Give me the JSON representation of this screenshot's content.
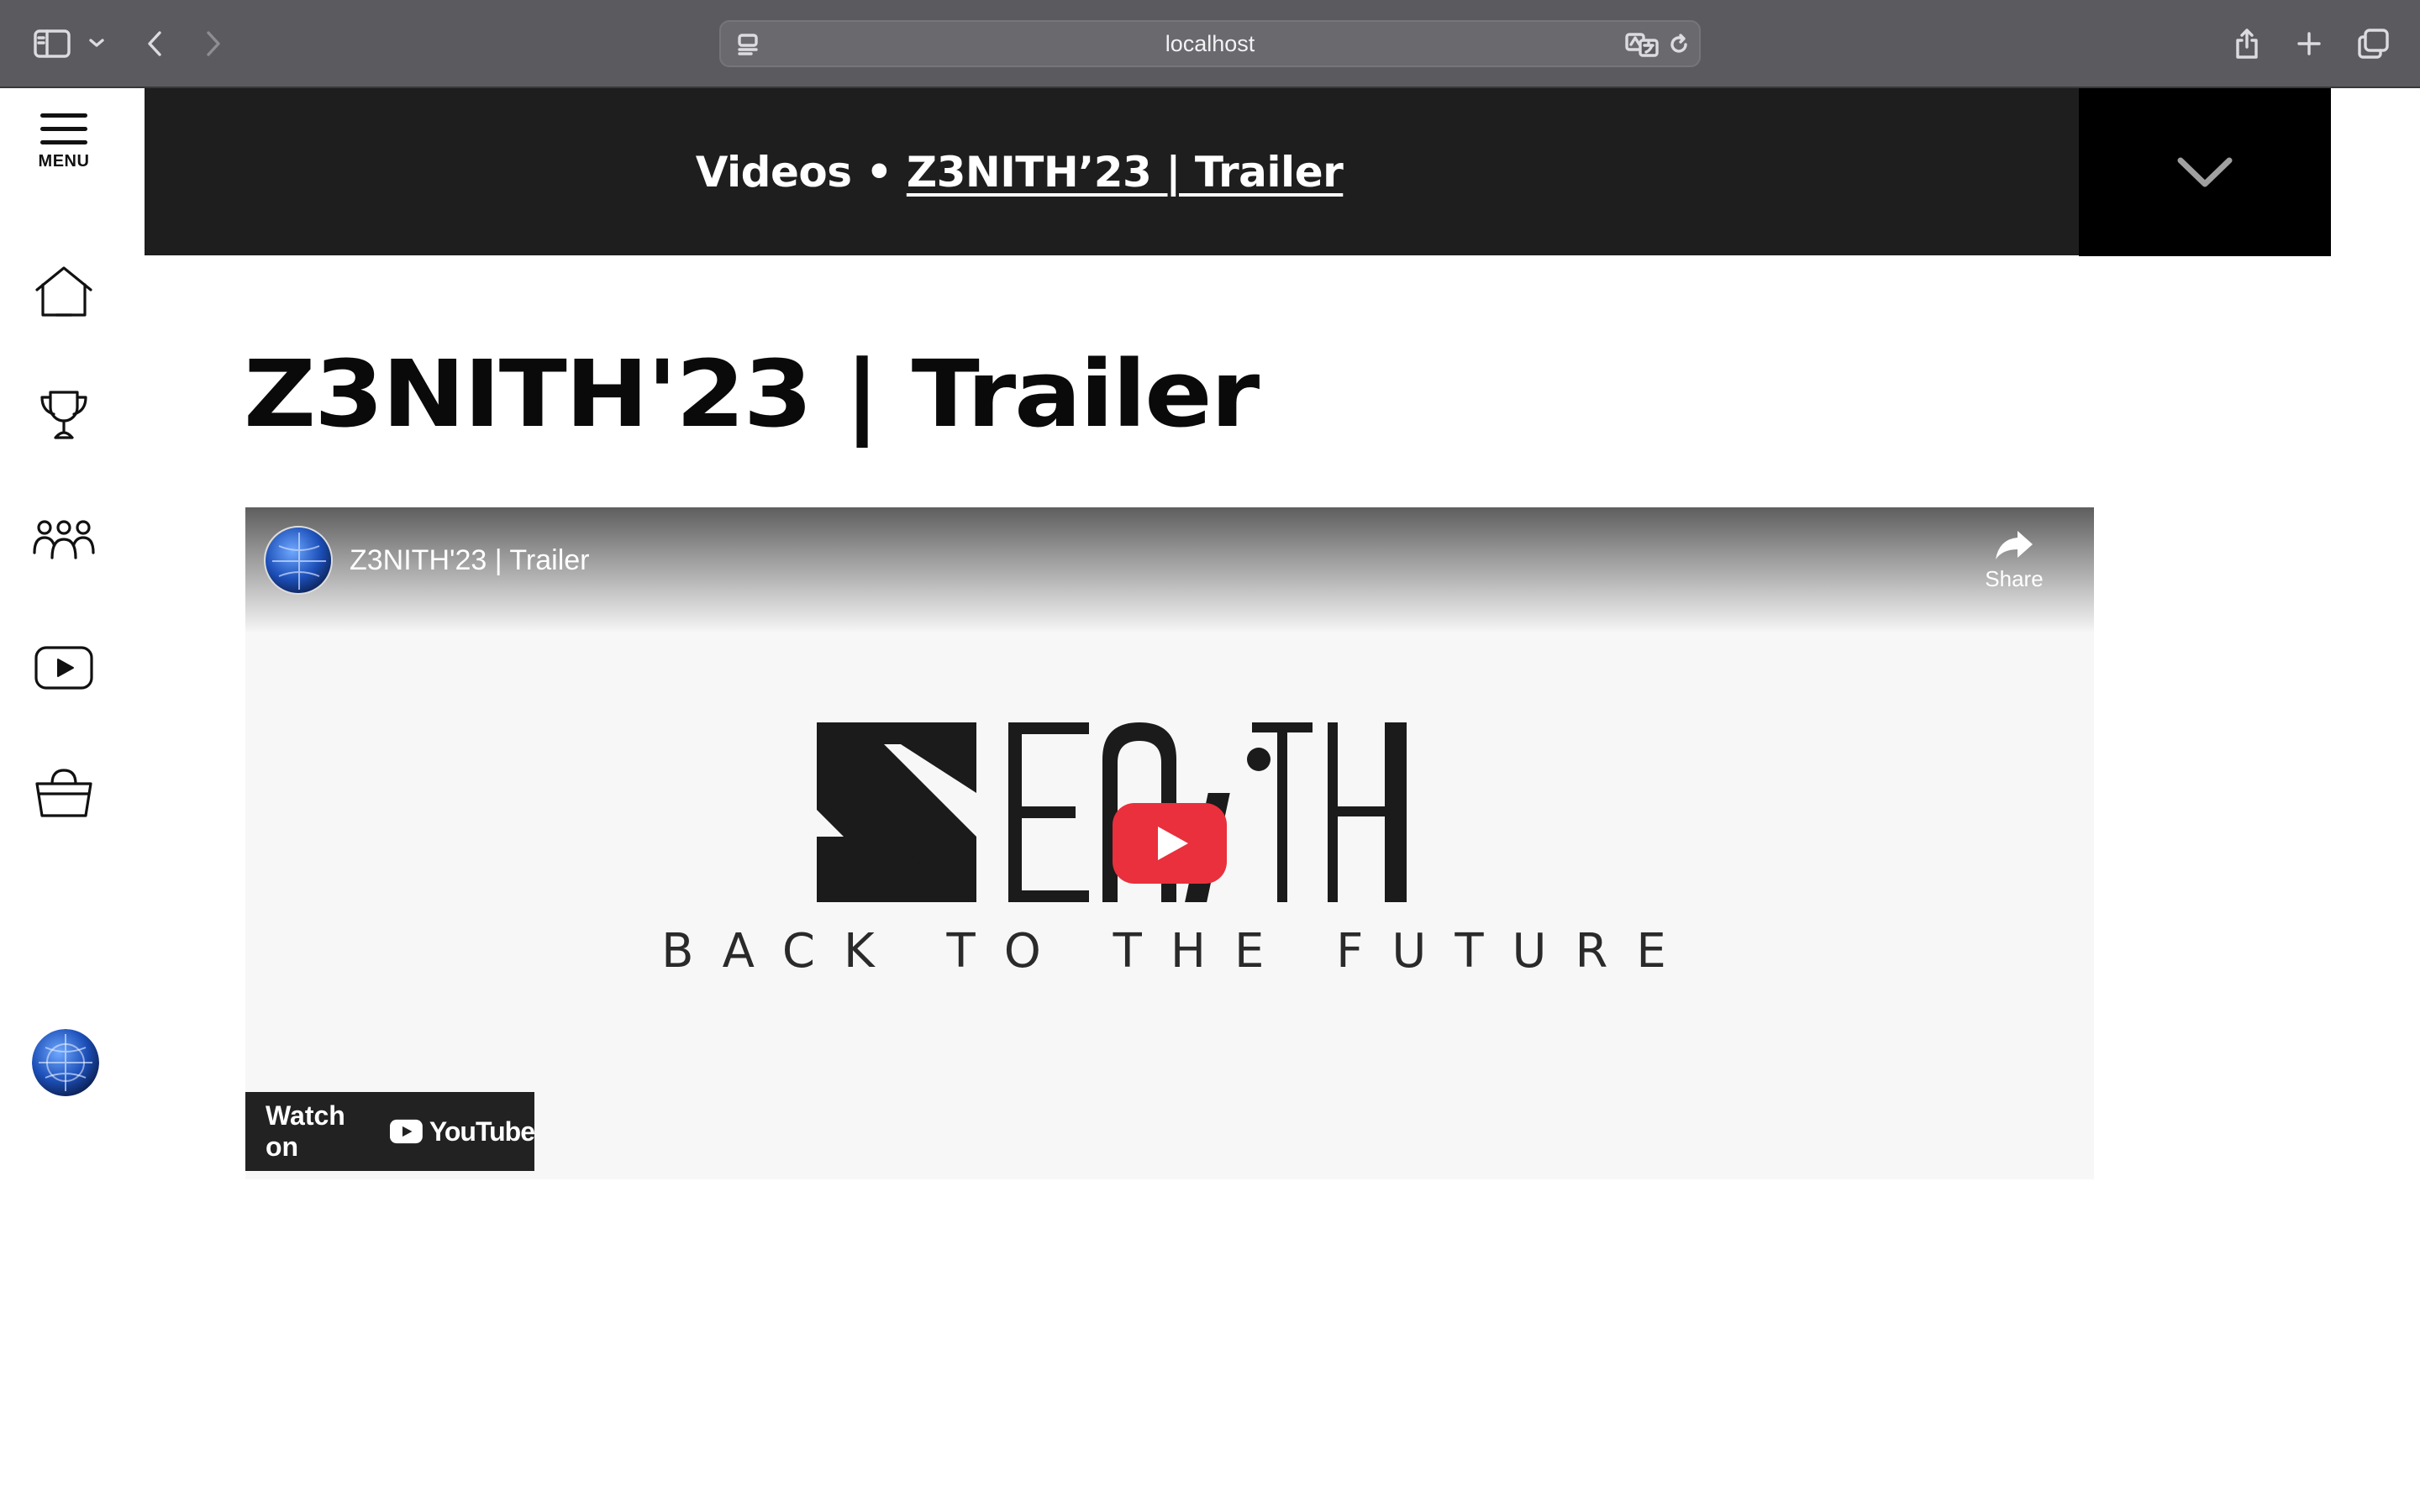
{
  "browser": {
    "address": "localhost"
  },
  "sidebar": {
    "menu_label": "MENU",
    "items": [
      {
        "name": "home",
        "icon": "home-icon"
      },
      {
        "name": "trophy",
        "icon": "trophy-icon"
      },
      {
        "name": "team",
        "icon": "people-icon"
      },
      {
        "name": "videos",
        "icon": "youtube-icon"
      },
      {
        "name": "shop",
        "icon": "basket-icon"
      }
    ]
  },
  "header": {
    "section": "Videos",
    "separator": "•",
    "current": "Z3NITH’23 | Trailer"
  },
  "page": {
    "title": "Z3NITH'23 | Trailer"
  },
  "video": {
    "title": "Z3NITH'23 | Trailer",
    "share_label": "Share",
    "logo_text": "ZENITH",
    "tagline": "BACK TO THE FUTURE",
    "watch_on_label": "Watch on",
    "youtube_wordmark": "YouTube",
    "play_color": "#e9303c"
  }
}
